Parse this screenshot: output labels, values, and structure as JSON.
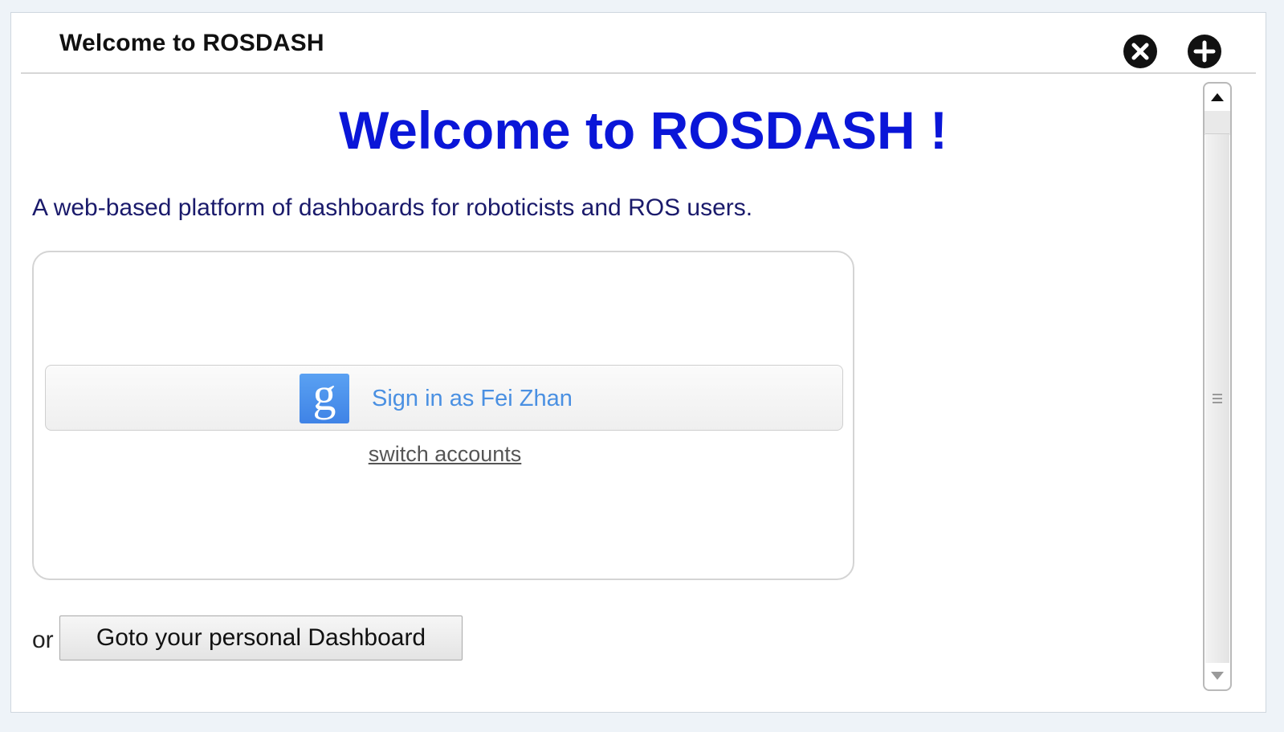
{
  "window": {
    "title": "Welcome to ROSDASH",
    "close_icon": "close-circle-icon",
    "add_icon": "add-circle-icon"
  },
  "main": {
    "heading": "Welcome to ROSDASH !",
    "tagline": "A web-based platform of dashboards for roboticists and ROS users."
  },
  "signin": {
    "google_icon": "google-g-icon",
    "button_label": "Sign in as Fei Zhan",
    "switch_label": "switch accounts"
  },
  "footer": {
    "or_text": "or",
    "dashboard_button_label": "Goto your personal Dashboard"
  },
  "colors": {
    "heading": "#0a16d8",
    "tagline": "#1a1a6b",
    "google_blue": "#4a90e2",
    "border": "#d4d4d4"
  }
}
